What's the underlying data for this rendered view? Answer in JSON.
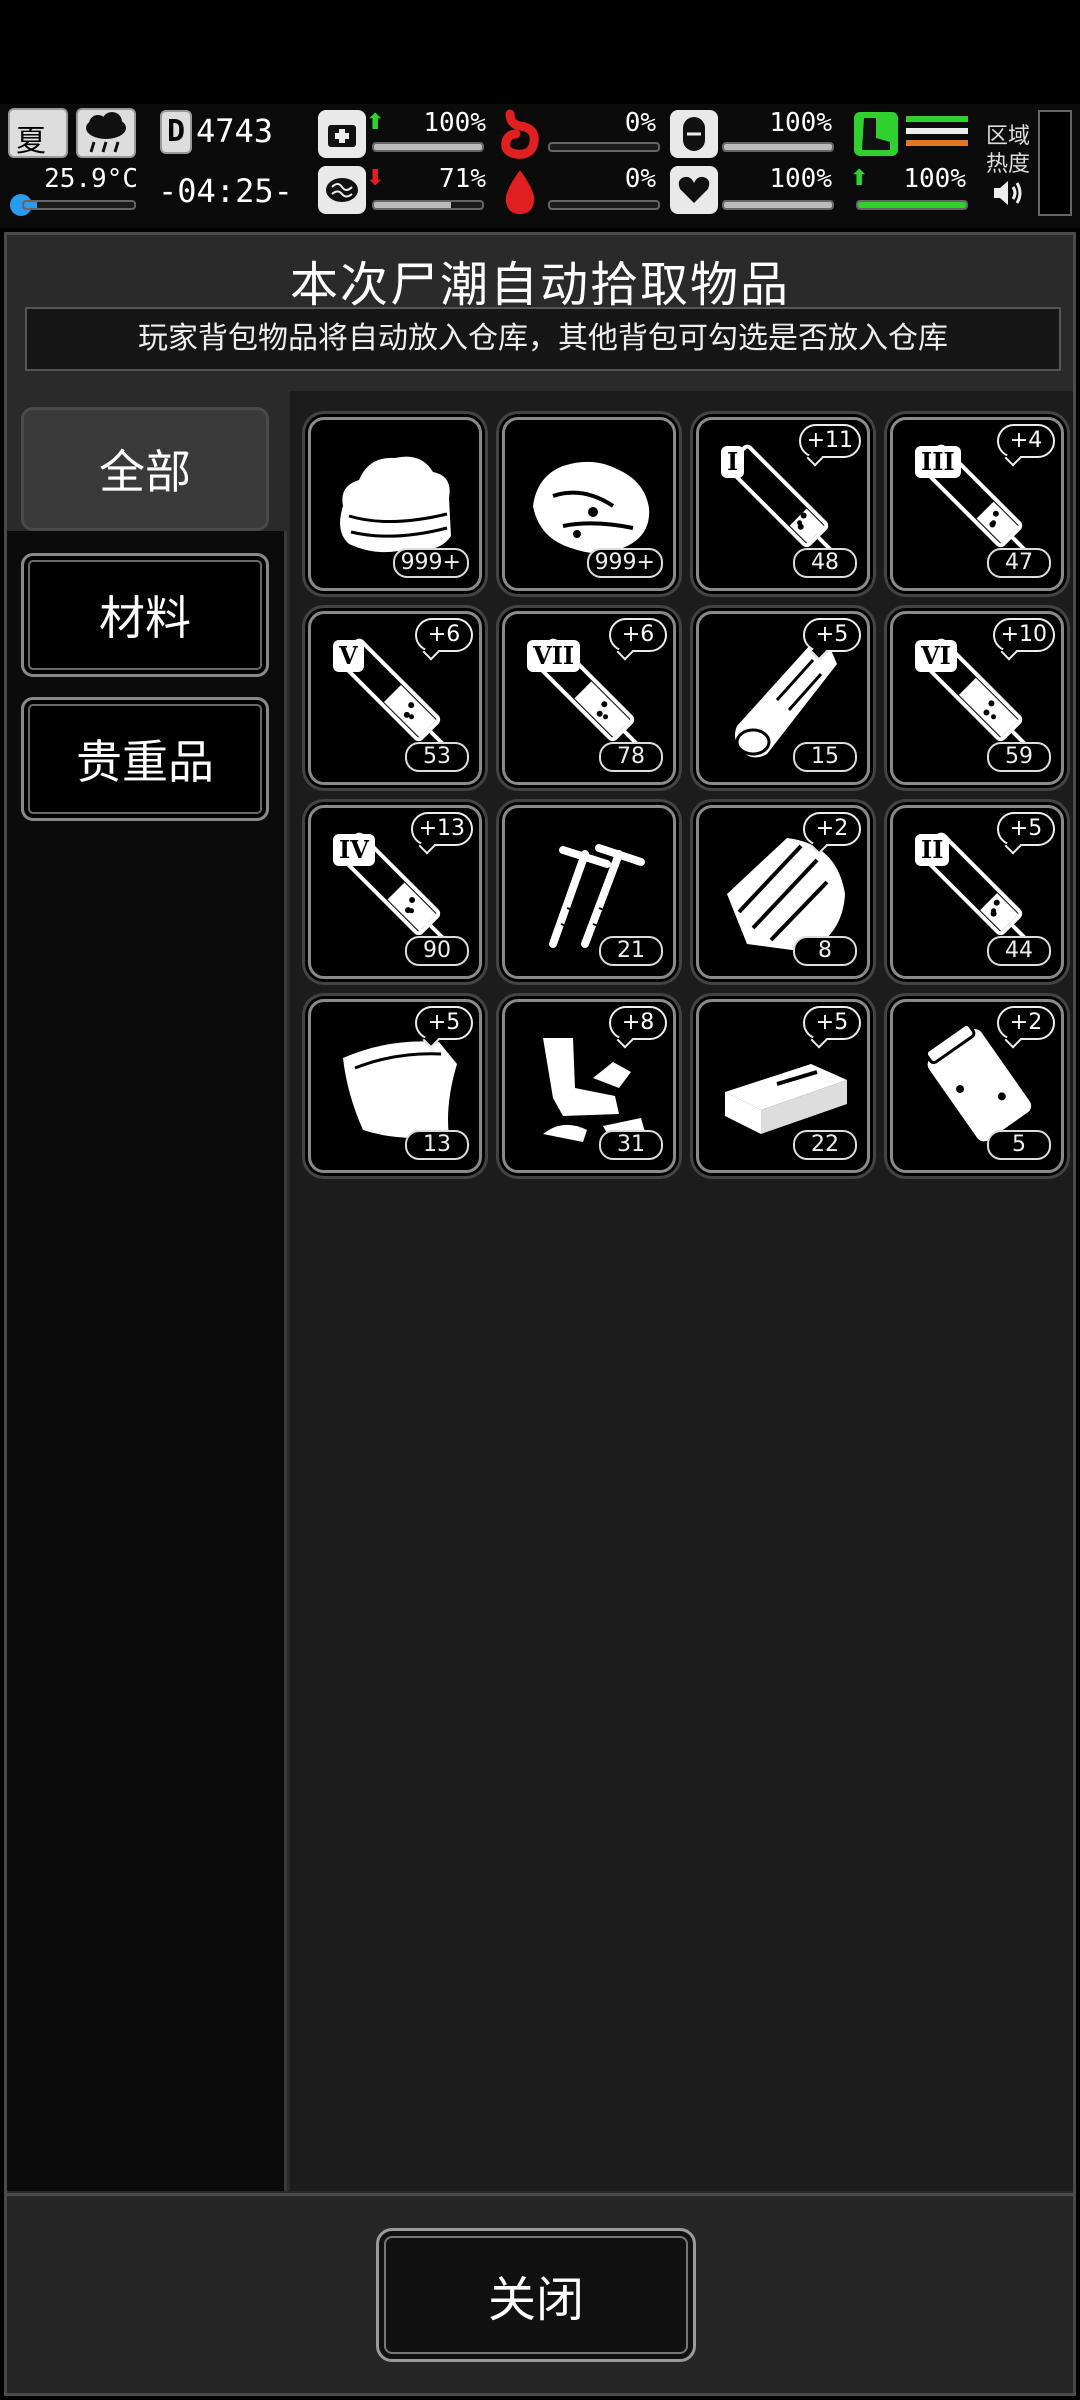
{
  "status_bar": {
    "season": "夏",
    "temperature": "25.9°C",
    "day": "4743",
    "time": "-04:25-",
    "health": "100%",
    "health_trend": "up",
    "sanity": "71%",
    "sanity_trend": "down",
    "hunger": "0%",
    "thirst": "0%",
    "stomach": "100%",
    "heart": "100%",
    "stamina": "100%",
    "stamina_trend": "up",
    "area_label_1": "区域",
    "area_label_2": "热度",
    "levels": {
      "health": 1.0,
      "sanity": 0.71,
      "hunger": 0,
      "thirst": 0,
      "stomach": 1.0,
      "heart": 1.0,
      "stamina": 1.0
    }
  },
  "panel": {
    "title": "本次尸潮自动拾取物品",
    "subtitle": "玩家背包物品将自动放入仓库，其他背包可勾选是否放入仓库"
  },
  "categories": [
    {
      "label": "全部",
      "active": true
    },
    {
      "label": "材料",
      "active": false
    },
    {
      "label": "贵重品",
      "active": false
    }
  ],
  "items": [
    {
      "icon": "cloth-icon",
      "count": "999+",
      "bonus": ""
    },
    {
      "icon": "meat-icon",
      "count": "999+",
      "bonus": ""
    },
    {
      "icon": "syringe-icon",
      "roman": "I",
      "count": "48",
      "bonus": "+11",
      "fill": 0.25
    },
    {
      "icon": "syringe-icon",
      "roman": "III",
      "count": "47",
      "bonus": "+4",
      "fill": 0.35
    },
    {
      "icon": "syringe-icon",
      "roman": "V",
      "count": "53",
      "bonus": "+6",
      "fill": 0.5
    },
    {
      "icon": "syringe-icon",
      "roman": "VII",
      "count": "78",
      "bonus": "+6",
      "fill": 0.55
    },
    {
      "icon": "wood-log-icon",
      "count": "15",
      "bonus": "+5"
    },
    {
      "icon": "syringe-icon",
      "roman": "VI",
      "count": "59",
      "bonus": "+10",
      "fill": 0.6
    },
    {
      "icon": "syringe-icon",
      "roman": "IV",
      "count": "90",
      "bonus": "+13",
      "fill": 0.45
    },
    {
      "icon": "nails-icon",
      "count": "21",
      "bonus": ""
    },
    {
      "icon": "wood-planks-icon",
      "count": "8",
      "bonus": "+2"
    },
    {
      "icon": "syringe-icon",
      "roman": "II",
      "count": "44",
      "bonus": "+5",
      "fill": 0.3
    },
    {
      "icon": "cloth-sheet-icon",
      "count": "13",
      "bonus": "+5"
    },
    {
      "icon": "scrap-parts-icon",
      "count": "31",
      "bonus": "+8"
    },
    {
      "icon": "brick-icon",
      "count": "22",
      "bonus": "+5"
    },
    {
      "icon": "plastic-bag-icon",
      "count": "5",
      "bonus": "+2"
    }
  ],
  "footer": {
    "close_label": "关闭"
  }
}
